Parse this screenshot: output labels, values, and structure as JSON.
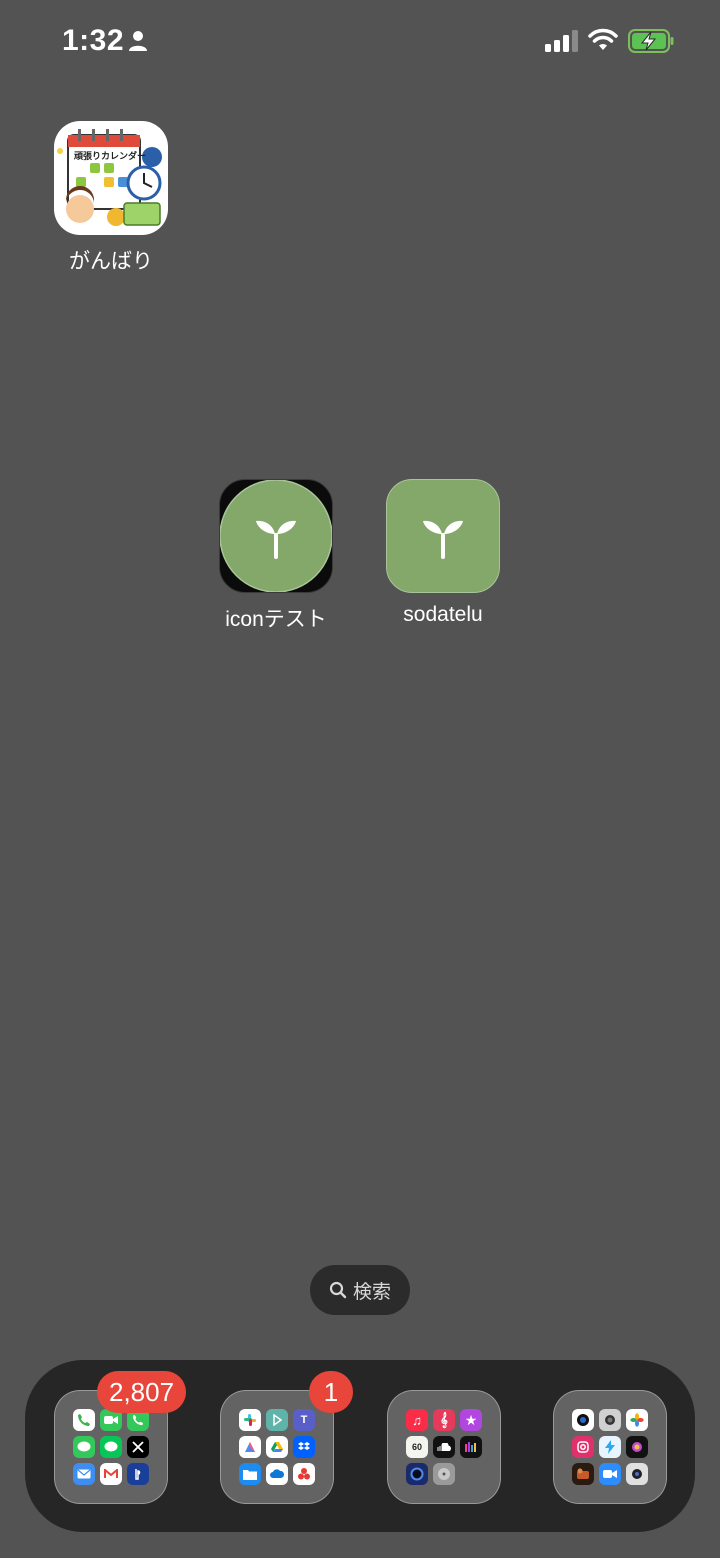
{
  "status_bar": {
    "time": "1:32"
  },
  "home": {
    "apps": [
      {
        "label": "がんばり",
        "icon": "calendar-app-icon"
      },
      {
        "label": "iconテスト",
        "icon": "sprout-icon"
      },
      {
        "label": "sodatelu",
        "icon": "sprout-icon"
      }
    ],
    "calendar_icon_text": "頑張りカレンダー"
  },
  "search": {
    "label": "検索"
  },
  "dock": {
    "folders": [
      {
        "badge": "2,807",
        "apps": [
          "phone-icon",
          "facetime-icon",
          "call-icon",
          "messages-icon",
          "line-icon",
          "x-icon",
          "mail-icon",
          "gmail-icon",
          "playstation-icon"
        ]
      },
      {
        "badge": "1",
        "apps": [
          "slack-icon",
          "play-icon",
          "teams-icon",
          "maps-icon",
          "drive-icon",
          "dropbox-icon",
          "files-icon",
          "cloud-icon",
          "craft-icon"
        ]
      },
      {
        "badge": "",
        "apps": [
          "music-icon",
          "clef-icon",
          "star-icon",
          "metronome-icon",
          "soundcloud-icon",
          "spectrum-icon",
          "dial-icon",
          "disc-icon"
        ]
      },
      {
        "badge": "",
        "apps": [
          "camera-lens-icon",
          "camera-icon",
          "photos-icon",
          "instagram-icon",
          "bolt-icon",
          "color-icon",
          "game-icon",
          "video-icon",
          "webcam-icon"
        ]
      }
    ],
    "metronome_value": "60"
  },
  "colors": {
    "background": "#535353",
    "sprout_green": "#84a86a",
    "badge_red": "#e8463a"
  }
}
